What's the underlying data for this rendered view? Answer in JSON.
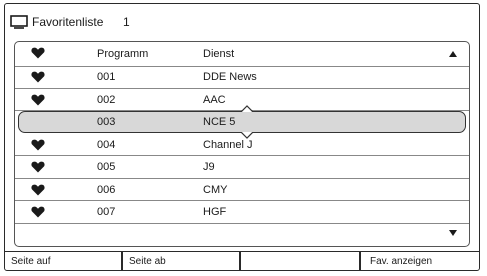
{
  "window": {
    "title": "Favoritenliste",
    "list_number": "1"
  },
  "table": {
    "headers": {
      "program": "Programm",
      "service": "Dienst"
    },
    "rows": [
      {
        "favorite": true,
        "program": "001",
        "service": "DDE News"
      },
      {
        "favorite": true,
        "program": "002",
        "service": "AAC"
      },
      {
        "favorite": false,
        "program": "003",
        "service": "NCE 5",
        "selected": true
      },
      {
        "favorite": true,
        "program": "004",
        "service": "Channel J"
      },
      {
        "favorite": true,
        "program": "005",
        "service": "J9"
      },
      {
        "favorite": true,
        "program": "006",
        "service": "CMY"
      },
      {
        "favorite": true,
        "program": "007",
        "service": "HGF"
      }
    ]
  },
  "footer": {
    "page_up": "Seite auf",
    "page_down": "Seite ab",
    "empty": "",
    "show_favorites": "Fav. anzeigen"
  },
  "icons": {
    "title": "tv-icon",
    "favorite": "heart-icon",
    "scroll_up": "triangle-up-icon",
    "scroll_down": "triangle-down-icon"
  }
}
